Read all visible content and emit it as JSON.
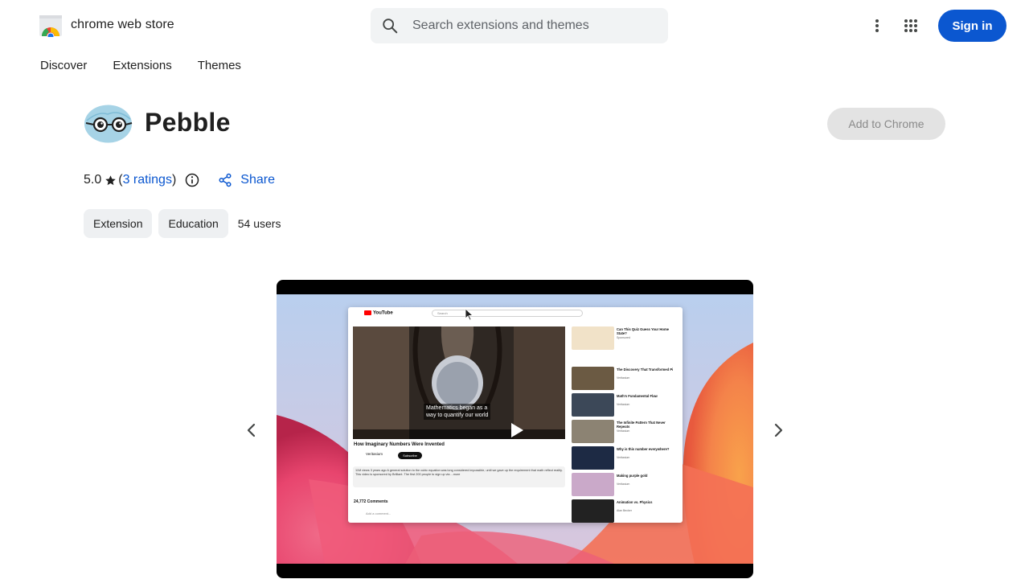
{
  "header": {
    "logo_text": "chrome web store",
    "search_placeholder": "Search extensions and themes",
    "signin_label": "Sign in"
  },
  "nav": {
    "items": [
      {
        "label": "Discover"
      },
      {
        "label": "Extensions"
      },
      {
        "label": "Themes"
      }
    ]
  },
  "extension": {
    "name": "Pebble",
    "add_label": "Add to Chrome",
    "rating": "5.0",
    "ratings_open": "(",
    "ratings_link": "3 ratings",
    "ratings_close": ")",
    "share_label": "Share",
    "chips": [
      {
        "label": "Extension"
      },
      {
        "label": "Education"
      }
    ],
    "users": "54 users"
  },
  "screenshot": {
    "yt_brand": "YouTube",
    "yt_search": "Search",
    "caption_line1": "Mathematics began as a",
    "caption_line2": "way to quantify our world",
    "video_title": "How Imaginary Numbers Were Invented",
    "channel": "Veritasium",
    "subscribe": "Subscribe",
    "description": "11M views  3 years ago  A general solution to the cubic equation was long considered impossible, until we gave up the requirement that math reflect reality. This video is sponsored by Brilliant. The first 200 people to sign up via ...more",
    "comments": "24,772 Comments",
    "add_comment": "Add a comment...",
    "side_videos": [
      {
        "title": "Can This Quiz Guess Your Home State?",
        "meta": "Sponsored"
      },
      {
        "title": "The Discovery That Transformed Pi",
        "meta": "Veritasium"
      },
      {
        "title": "Math's Fundamental Flaw",
        "meta": "Veritasium"
      },
      {
        "title": "The Infinite Pattern That Never Repeats",
        "meta": "Veritasium"
      },
      {
        "title": "Why is this number everywhere?",
        "meta": "Veritasium"
      },
      {
        "title": "Making purple gold",
        "meta": "Veritasium"
      },
      {
        "title": "Animation vs. Physics",
        "meta": "Alan Becker"
      }
    ]
  },
  "colors": {
    "accent": "#0b57d0",
    "chip_bg": "#eef0f2",
    "disabled_btn_bg": "#e3e3e3"
  }
}
